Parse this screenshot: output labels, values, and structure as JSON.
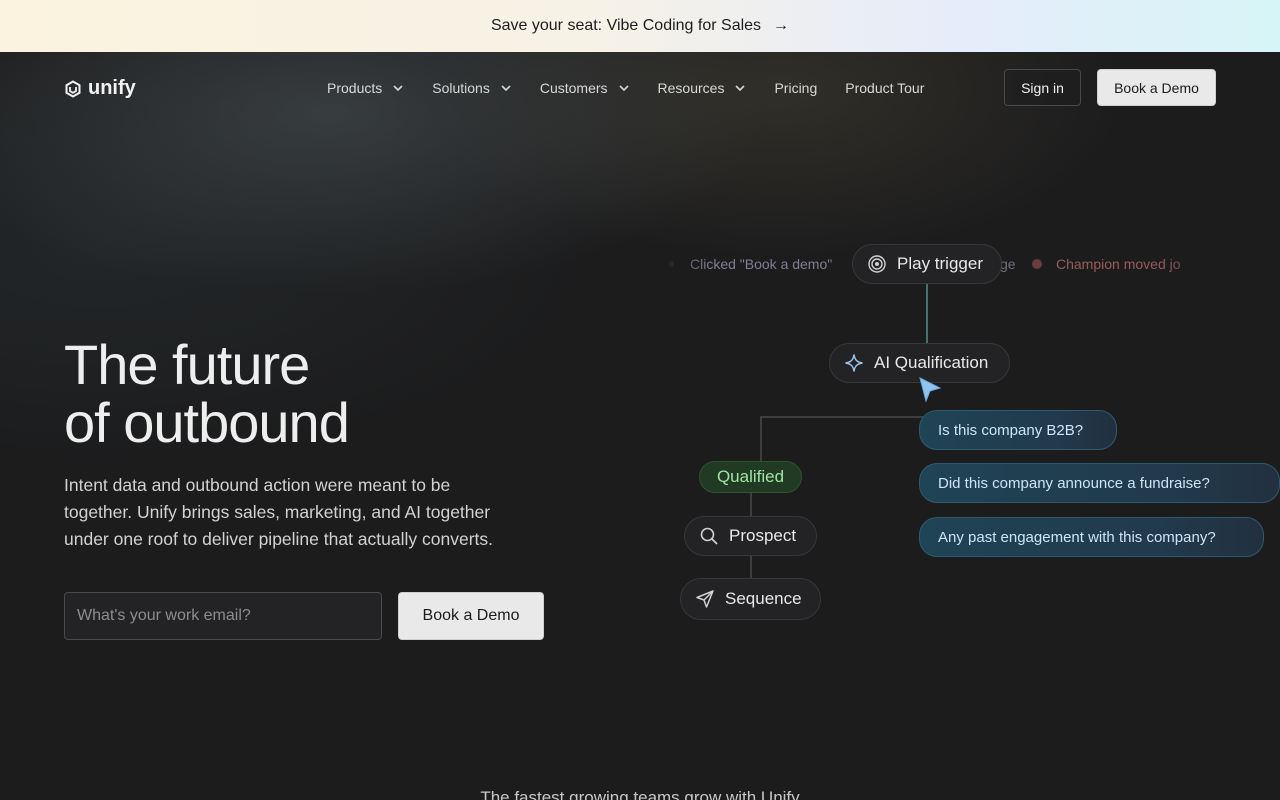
{
  "banner": {
    "text": "Save your seat: Vibe Coding for Sales",
    "arrow": "→"
  },
  "nav": {
    "logo_text": "unify",
    "links": [
      {
        "label": "Products",
        "has_dropdown": true
      },
      {
        "label": "Solutions",
        "has_dropdown": true
      },
      {
        "label": "Customers",
        "has_dropdown": true
      },
      {
        "label": "Resources",
        "has_dropdown": true
      },
      {
        "label": "Pricing",
        "has_dropdown": false
      },
      {
        "label": "Product Tour",
        "has_dropdown": false
      }
    ],
    "sign_in": "Sign in",
    "book_demo": "Book a Demo"
  },
  "hero": {
    "title_line1": "The future",
    "title_line2": "of outbound",
    "subtitle": "Intent data and outbound action were meant to be together. Unify brings sales, marketing, and AI together under one roof to deliver pipeline that actually converts.",
    "email_placeholder": "What's your work email?",
    "cta": "Book a Demo"
  },
  "flow": {
    "ticker_left": "Clicked \"Book a demo\"",
    "ticker_mid": "ge",
    "ticker_right": "Champion moved jo",
    "play_trigger": "Play trigger",
    "ai_qualification": "AI Qualification",
    "qualified": "Qualified",
    "prospect": "Prospect",
    "sequence": "Sequence",
    "questions": [
      "Is this company B2B?",
      "Did this company announce a fundraise?",
      "Any past engagement with this company?"
    ]
  },
  "footer_tease": "The fastest growing teams grow with Unify",
  "colors": {
    "background": "#1c1c1d",
    "qualified_green": "#9fe3a6",
    "question_blue": "#1f4456",
    "cursor_blue": "#8ec5f0"
  },
  "icons": [
    "unify-logo-icon",
    "chevron-down-icon",
    "target-icon",
    "sparkle-icon",
    "search-icon",
    "send-icon",
    "cursor-pointer-icon"
  ]
}
